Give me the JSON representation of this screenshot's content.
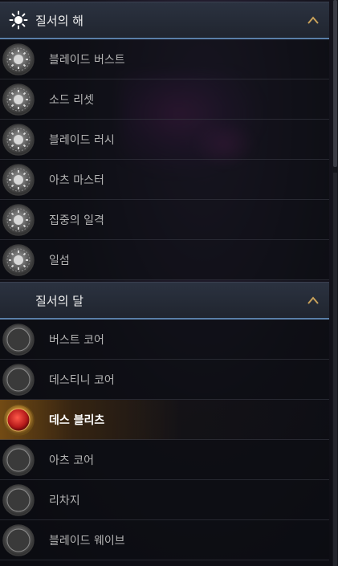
{
  "sections": [
    {
      "title": "질서의 해",
      "icon": "sun-icon",
      "items": [
        {
          "label": "블레이드 버스트",
          "icon": "sun-skill-icon"
        },
        {
          "label": "소드 리셋",
          "icon": "sun-skill-icon"
        },
        {
          "label": "블레이드 러시",
          "icon": "sun-skill-icon"
        },
        {
          "label": "아츠 마스터",
          "icon": "sun-skill-icon"
        },
        {
          "label": "집중의 일격",
          "icon": "sun-skill-icon"
        },
        {
          "label": "일섬",
          "icon": "sun-skill-icon"
        }
      ]
    },
    {
      "title": "질서의 달",
      "icon": "moon-icon",
      "items": [
        {
          "label": "버스트 코어",
          "icon": "moon-skill-icon"
        },
        {
          "label": "데스티니 코어",
          "icon": "moon-skill-icon"
        },
        {
          "label": "데스 블리츠",
          "icon": "moon-skill-icon",
          "selected": true
        },
        {
          "label": "아츠 코어",
          "icon": "moon-skill-icon"
        },
        {
          "label": "리차지",
          "icon": "moon-skill-icon"
        },
        {
          "label": "블레이드 웨이브",
          "icon": "moon-skill-icon"
        }
      ]
    }
  ],
  "colors": {
    "header_border": "#5a7fa8",
    "chevron": "#c9a25a",
    "selected_accent": "#c0392b"
  }
}
